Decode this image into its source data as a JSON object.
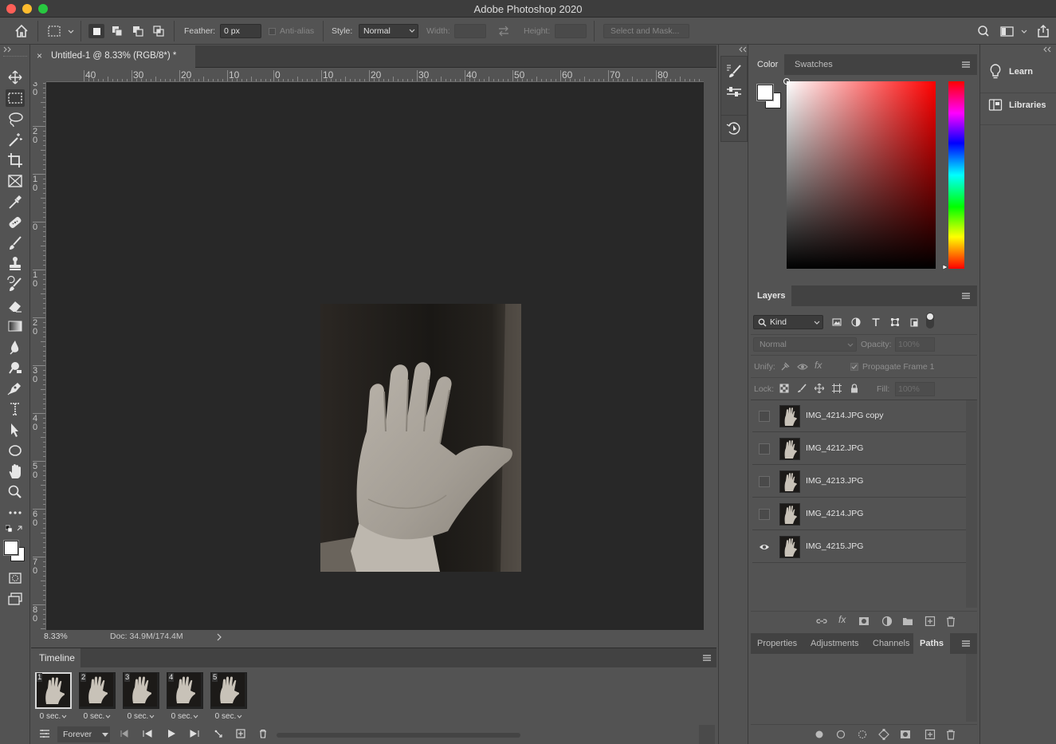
{
  "app": {
    "title": "Adobe Photoshop 2020"
  },
  "options": {
    "feather_label": "Feather:",
    "feather_value": "0 px",
    "antialias_label": "Anti-alias",
    "style_label": "Style:",
    "style_value": "Normal",
    "width_label": "Width:",
    "height_label": "Height:",
    "select_mask": "Select and Mask..."
  },
  "document": {
    "tab_title": "Untitled-1 @ 8.33% (RGB/8*) *",
    "close": "×",
    "zoom": "8.33%",
    "doc_info": "Doc: 34.9M/174.4M",
    "hruler_ticks": [
      "40",
      "30",
      "20",
      "10",
      "0",
      "10",
      "20",
      "30",
      "40",
      "50",
      "60",
      "70",
      "80"
    ],
    "vruler_ticks": [
      [
        "3",
        "0"
      ],
      [
        "2",
        "0"
      ],
      [
        "1",
        "0"
      ],
      [
        "0"
      ],
      [
        "1",
        "0"
      ],
      [
        "2",
        "0"
      ],
      [
        "3",
        "0"
      ],
      [
        "4",
        "0"
      ],
      [
        "5",
        "0"
      ],
      [
        "6",
        "0"
      ],
      [
        "7",
        "0"
      ],
      [
        "8",
        "0"
      ]
    ]
  },
  "timeline": {
    "title": "Timeline",
    "loop": "Forever",
    "frames": [
      {
        "num": "1",
        "delay": "0 sec."
      },
      {
        "num": "2",
        "delay": "0 sec."
      },
      {
        "num": "3",
        "delay": "0 sec."
      },
      {
        "num": "4",
        "delay": "0 sec."
      },
      {
        "num": "5",
        "delay": "0 sec."
      }
    ]
  },
  "color_panel": {
    "tabs": [
      "Color",
      "Swatches"
    ]
  },
  "layers_panel": {
    "title": "Layers",
    "kind": "Kind",
    "blend": "Normal",
    "opacity_label": "Opacity:",
    "opacity_value": "100%",
    "unify_label": "Unify:",
    "propagate": "Propagate Frame 1",
    "lock_label": "Lock:",
    "fill_label": "Fill:",
    "fill_value": "100%",
    "layers": [
      {
        "name": "IMG_4214.JPG copy",
        "visible": false
      },
      {
        "name": "IMG_4212.JPG",
        "visible": false
      },
      {
        "name": "IMG_4213.JPG",
        "visible": false
      },
      {
        "name": "IMG_4214.JPG",
        "visible": false
      },
      {
        "name": "IMG_4215.JPG",
        "visible": true
      }
    ]
  },
  "bottom_panel": {
    "tabs": [
      "Properties",
      "Adjustments",
      "Channels",
      "Paths"
    ]
  },
  "learn_panel": {
    "learn": "Learn",
    "libraries": "Libraries"
  }
}
